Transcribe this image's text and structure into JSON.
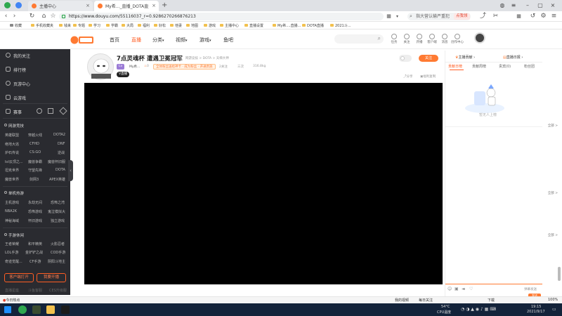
{
  "browser": {
    "tabs": [
      {
        "label": "主播中心",
        "active": false
      },
      {
        "label": "My希..._直播_DOTA直播_斗鱼直...",
        "active": true
      }
    ],
    "url_host": "https://www.douyu.com/",
    "url_path": "55116037_r=0.9286270266876213",
    "search_text": "指大营认输严重犯",
    "ad_text": "点我领",
    "bookmarks": [
      "收藏",
      "手机收藏夹",
      "钱来",
      "专题",
      "学习",
      "学霸",
      "大局",
      "福利",
      "好松",
      "他妻",
      "地图",
      "游戏",
      "主播中心",
      "直播设置",
      "My希....直播...",
      "DOTA直播",
      "2021斗..."
    ]
  },
  "douyu": {
    "nav": [
      "首页",
      "直播",
      "分类",
      "视频",
      "游戏",
      "鱼吧"
    ],
    "top_icons": [
      "任务",
      "关注",
      "开播",
      "客户端",
      "消息",
      "创作中心"
    ]
  },
  "sidebar": {
    "top_items": [
      "我的关注",
      "排行榜",
      "页游中心",
      "云游戏"
    ],
    "event_item": "赛事",
    "sections": [
      {
        "title": "网游竞技",
        "more": "全部 >",
        "cells": [
          [
            "英雄联盟",
            "穿越火线",
            "DOTA2"
          ],
          [
            "绝地大逃",
            "CFHD",
            "DNF"
          ],
          [
            "炉石传说",
            "CS:GO",
            "逆战"
          ],
          [
            "lol云顶之...",
            "魔兽争霸",
            "魔兽怀旧服"
          ],
          [
            "坦克世界",
            "守望先锋",
            "DOTA"
          ],
          [
            "魔兽世界",
            "剑网3",
            "APEX英雄"
          ]
        ]
      },
      {
        "title": "单机热游",
        "more": "全部 >",
        "cells": [
          [
            "主机游戏",
            "永劫无间",
            "恐怖之湾"
          ],
          [
            "NBA2K",
            "恐怖游戏",
            "鬼泣模拟大"
          ],
          [
            "神秘海域",
            "怀旧游戏",
            "独立游戏"
          ]
        ]
      },
      {
        "title": "手游休闲",
        "more": "全部 >",
        "cells": [
          [
            "王者荣耀",
            "和平精英",
            "火影忍者"
          ],
          [
            "LOL手游",
            "金铲铲之战",
            "COD手游"
          ],
          [
            "奇迹觉醒...",
            "CF手游",
            "阴阳斗地主"
          ]
        ]
      }
    ],
    "btn_open": "客户端打开",
    "btn_play": "我要开播",
    "footer": [
      "直播星座",
      "斗鱼客服",
      "CES升级服"
    ]
  },
  "room": {
    "title": "7点灵魂杯 遭遇卫冕冠军",
    "report": "举报",
    "category": "网游竞技 > DOTA > 天梯大神",
    "level": "Lv",
    "streamer": "My希...",
    "likes": "0",
    "notice": "全体粉丝送给神卡 · 成为粉丝 · 开通贵族",
    "fans": "2关注",
    "hot": "三次",
    "score": "316.8kg",
    "tag": "V直播",
    "follow": "关注",
    "share": "分享",
    "report_link": "福利复制"
  },
  "right_panel": {
    "top_left": "主播贡献",
    "top_right": "直播日报",
    "tabs": [
      "贡献日榜",
      "贡献周榜",
      "贵宾(0)",
      "粉丝团"
    ],
    "empty_text": "暂无人上榜",
    "chat_hint": "弹幕发送",
    "send": "发送"
  },
  "statusbar": {
    "left": "今日热点",
    "items": [
      "我的视频",
      "每日关注",
      "下载",
      "100%"
    ]
  },
  "taskbar": {
    "temp": "54°C",
    "cpu": "CPU温度",
    "time": "19:15",
    "date": "2021/9/17"
  }
}
